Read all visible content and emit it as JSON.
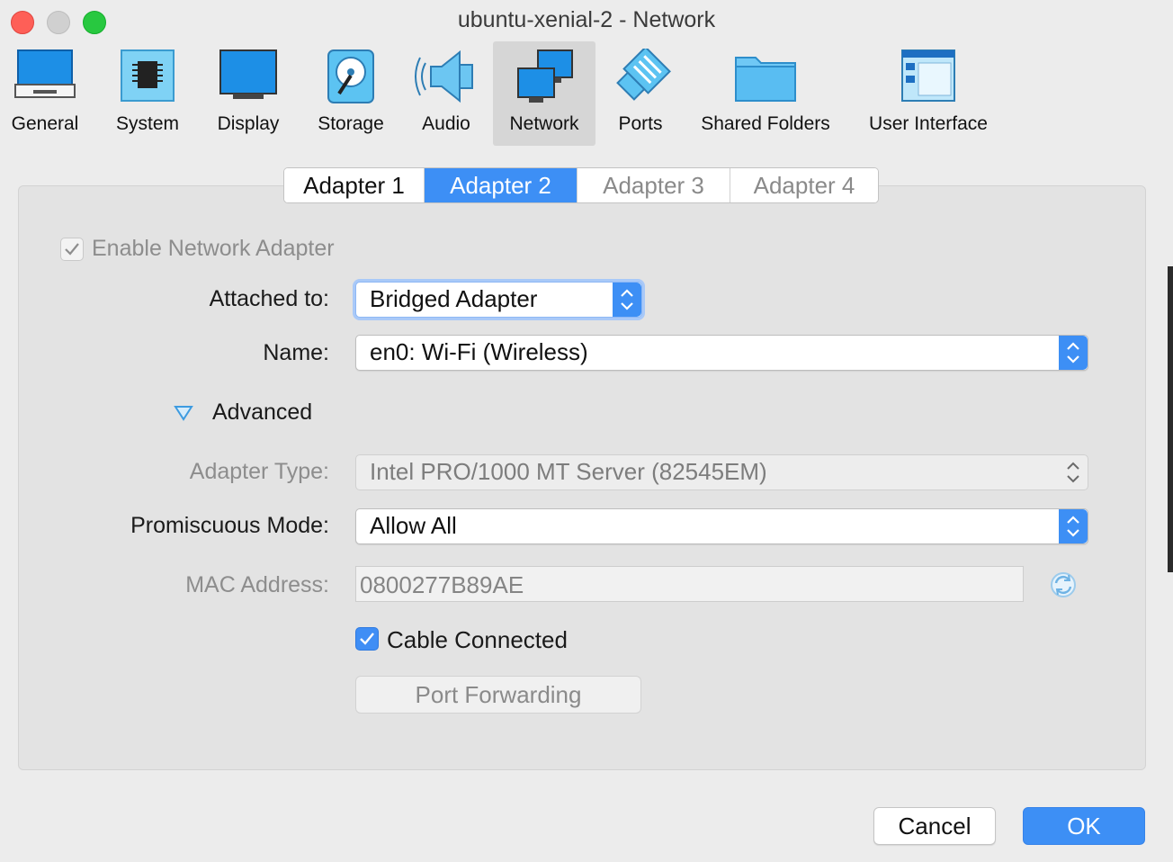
{
  "window": {
    "title": "ubuntu-xenial-2 - Network"
  },
  "toolbar": {
    "items": [
      {
        "label": "General",
        "icon": "general-monitor-icon"
      },
      {
        "label": "System",
        "icon": "chip-icon"
      },
      {
        "label": "Display",
        "icon": "monitor-icon"
      },
      {
        "label": "Storage",
        "icon": "disk-icon"
      },
      {
        "label": "Audio",
        "icon": "speaker-icon"
      },
      {
        "label": "Network",
        "icon": "network-icon",
        "selected": true
      },
      {
        "label": "Ports",
        "icon": "serial-port-icon"
      },
      {
        "label": "Shared Folders",
        "icon": "folder-icon"
      },
      {
        "label": "User Interface",
        "icon": "window-layout-icon"
      }
    ]
  },
  "tabs": {
    "adapter1": "Adapter 1",
    "adapter2": "Adapter 2",
    "adapter3": "Adapter 3",
    "adapter4": "Adapter 4",
    "active": "Adapter 2"
  },
  "form": {
    "enable_label": "Enable Network Adapter",
    "attached_label": "Attached to:",
    "attached_value": "Bridged Adapter",
    "name_label": "Name:",
    "name_value": "en0: Wi-Fi (Wireless)",
    "advanced_label": "Advanced",
    "adapter_type_label": "Adapter Type:",
    "adapter_type_value": "Intel PRO/1000 MT Server (82545EM)",
    "promiscuous_label": "Promiscuous Mode:",
    "promiscuous_value": "Allow All",
    "mac_label": "MAC Address:",
    "mac_value": "0800277B89AE",
    "cable_label": "Cable Connected",
    "port_forwarding_label": "Port Forwarding"
  },
  "footer": {
    "cancel": "Cancel",
    "ok": "OK"
  },
  "colors": {
    "accent": "#3d8ff5",
    "close": "#fe5f57",
    "zoom": "#28c840",
    "minimize_inactive": "#d0d0d0"
  }
}
